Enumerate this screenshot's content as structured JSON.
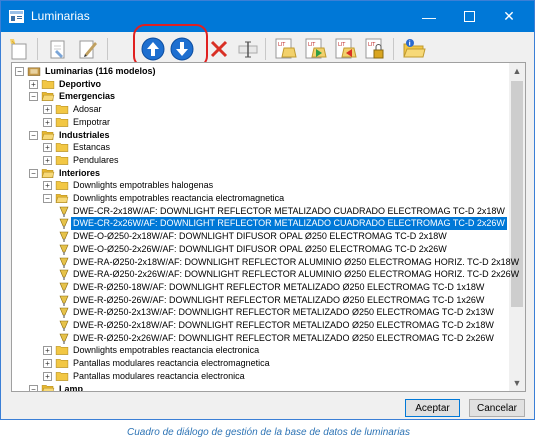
{
  "window": {
    "title": "Luminarias"
  },
  "toolbar": {
    "buttons": [
      {
        "icon": "new-document-icon"
      },
      {
        "icon": "edit-document-icon"
      },
      {
        "icon": "edit-pencil-icon"
      },
      {
        "icon": "move-up-icon"
      },
      {
        "icon": "move-down-icon"
      },
      {
        "icon": "delete-icon"
      },
      {
        "icon": "text-cursor-icon"
      },
      {
        "icon": "luminaire-file-icon"
      },
      {
        "icon": "luminaire-import-icon"
      },
      {
        "icon": "luminaire-export-icon"
      },
      {
        "icon": "luminaire-lock-icon"
      },
      {
        "icon": "info-folder-icon"
      }
    ],
    "highlight_color": "#e02020"
  },
  "tree": {
    "items": [
      {
        "label": "Luminarias (116 modelos)",
        "level": 0,
        "type": "root",
        "expander": "−",
        "bold": true
      },
      {
        "label": "Deportivo",
        "level": 1,
        "type": "folder",
        "expander": "+",
        "bold": true
      },
      {
        "label": "Emergencias",
        "level": 1,
        "type": "folder-open",
        "expander": "−",
        "bold": true
      },
      {
        "label": "Adosar",
        "level": 2,
        "type": "folder",
        "expander": "+",
        "bold": false
      },
      {
        "label": "Empotrar",
        "level": 2,
        "type": "folder",
        "expander": "+",
        "bold": false
      },
      {
        "label": "Industriales",
        "level": 1,
        "type": "folder-open",
        "expander": "−",
        "bold": true
      },
      {
        "label": "Estancas",
        "level": 2,
        "type": "folder",
        "expander": "+",
        "bold": false
      },
      {
        "label": "Pendulares",
        "level": 2,
        "type": "folder",
        "expander": "+",
        "bold": false
      },
      {
        "label": "Interiores",
        "level": 1,
        "type": "folder-open",
        "expander": "−",
        "bold": true
      },
      {
        "label": "Downlights empotrables halogenas",
        "level": 2,
        "type": "folder",
        "expander": "+",
        "bold": false
      },
      {
        "label": "Downlights empotrables reactancia electromagnetica",
        "level": 2,
        "type": "folder-open",
        "expander": "−",
        "bold": false
      },
      {
        "label": "DWE-CR-2x18W/AF: DOWNLIGHT REFLECTOR METALIZADO CUADRADO ELECTROMAG TC-D 2x18W",
        "level": 3,
        "type": "lamp",
        "expander": "",
        "bold": false
      },
      {
        "label": "DWE-CR-2x26W/AF: DOWNLIGHT REFLECTOR METALIZADO CUADRADO ELECTROMAG TC-D 2x26W",
        "level": 3,
        "type": "lamp",
        "expander": "",
        "bold": false,
        "selected": true
      },
      {
        "label": "DWE-O-Ø250-2x18W/AF: DOWNLIGHT DIFUSOR OPAL Ø250 ELECTROMAG TC-D 2x18W",
        "level": 3,
        "type": "lamp",
        "expander": "",
        "bold": false
      },
      {
        "label": "DWE-O-Ø250-2x26W/AF: DOWNLIGHT DIFUSOR OPAL Ø250 ELECTROMAG TC-D 2x26W",
        "level": 3,
        "type": "lamp",
        "expander": "",
        "bold": false
      },
      {
        "label": "DWE-RA-Ø250-2x18W/AF: DOWNLIGHT REFLECTOR ALUMINIO Ø250 ELECTROMAG HORIZ. TC-D 2x18W",
        "level": 3,
        "type": "lamp",
        "expander": "",
        "bold": false
      },
      {
        "label": "DWE-RA-Ø250-2x26W/AF: DOWNLIGHT REFLECTOR ALUMINIO Ø250 ELECTROMAG HORIZ. TC-D 2x26W",
        "level": 3,
        "type": "lamp",
        "expander": "",
        "bold": false
      },
      {
        "label": "DWE-R-Ø250-18W/AF: DOWNLIGHT REFLECTOR METALIZADO Ø250 ELECTROMAG TC-D 1x18W",
        "level": 3,
        "type": "lamp",
        "expander": "",
        "bold": false
      },
      {
        "label": "DWE-R-Ø250-26W/AF: DOWNLIGHT REFLECTOR METALIZADO Ø250 ELECTROMAG TC-D 1x26W",
        "level": 3,
        "type": "lamp",
        "expander": "",
        "bold": false
      },
      {
        "label": "DWE-R-Ø250-2x13W/AF: DOWNLIGHT REFLECTOR METALIZADO Ø250 ELECTROMAG TC-D 2x13W",
        "level": 3,
        "type": "lamp",
        "expander": "",
        "bold": false
      },
      {
        "label": "DWE-R-Ø250-2x18W/AF: DOWNLIGHT REFLECTOR METALIZADO Ø250 ELECTROMAG TC-D 2x18W",
        "level": 3,
        "type": "lamp",
        "expander": "",
        "bold": false
      },
      {
        "label": "DWE-R-Ø250-2x26W/AF: DOWNLIGHT REFLECTOR METALIZADO Ø250 ELECTROMAG TC-D 2x26W",
        "level": 3,
        "type": "lamp",
        "expander": "",
        "bold": false
      },
      {
        "label": "Downlights empotrables reactancia electronica",
        "level": 2,
        "type": "folder",
        "expander": "+",
        "bold": false
      },
      {
        "label": "Pantallas modulares reactancia electromagnetica",
        "level": 2,
        "type": "folder",
        "expander": "+",
        "bold": false
      },
      {
        "label": "Pantallas modulares reactancia electronica",
        "level": 2,
        "type": "folder",
        "expander": "+",
        "bold": false
      },
      {
        "label": "Lamp",
        "level": 1,
        "type": "folder-open",
        "expander": "−",
        "bold": true
      }
    ]
  },
  "buttons": {
    "accept": "Aceptar",
    "cancel": "Cancelar"
  },
  "caption": "Cuadro de diálogo de gestión de la base de datos de luminarias",
  "colors": {
    "titlebar": "#0078d7",
    "selection": "#0078d7",
    "caption": "#2e74b5",
    "folder": "#f5c542"
  }
}
